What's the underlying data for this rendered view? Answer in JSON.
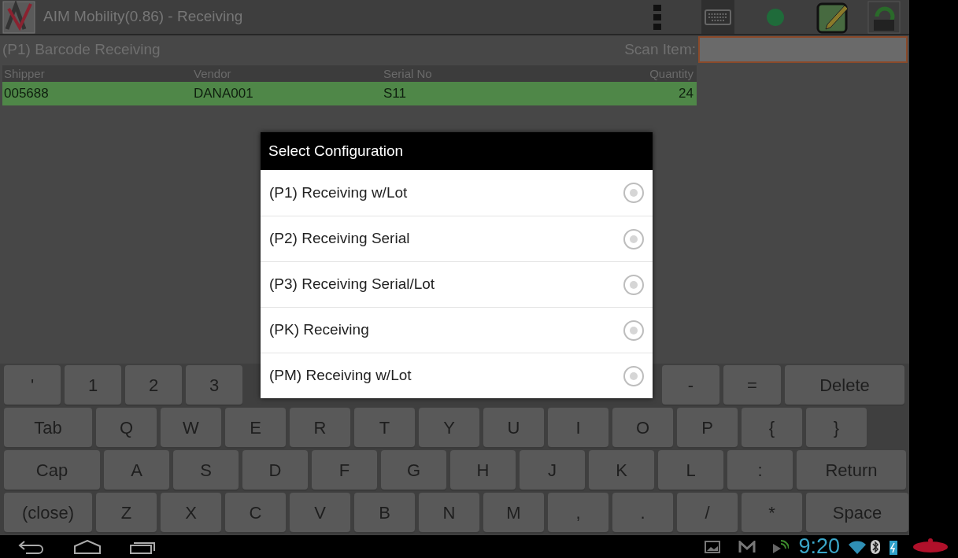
{
  "window": {
    "title": "AIM Mobility(0.86) - Receiving"
  },
  "screen": {
    "title": "(P1) Barcode Receiving",
    "scan_label": "Scan Item:"
  },
  "table": {
    "columns": [
      "Shipper",
      "Vendor",
      "Serial No",
      "Quantity"
    ],
    "rows": [
      {
        "cells": [
          "005688",
          "DANA001",
          "S11",
          "24"
        ],
        "selected": true
      }
    ]
  },
  "dialog": {
    "title": "Select Configuration",
    "options": [
      {
        "label": "(P1) Receiving w/Lot",
        "selected": false
      },
      {
        "label": "(P2) Receiving Serial",
        "selected": false
      },
      {
        "label": "(P3) Receiving Serial/Lot",
        "selected": false
      },
      {
        "label": "(PK) Receiving",
        "selected": false
      },
      {
        "label": "(PM) Receiving w/Lot",
        "selected": false
      }
    ]
  },
  "keyboard": {
    "rows": [
      {
        "keys": [
          "'",
          "1",
          "2",
          "3",
          "-",
          "=",
          "Delete"
        ]
      },
      {
        "keys": [
          "Tab",
          "Q",
          "W",
          "E",
          "R",
          "T",
          "Y",
          "U",
          "I",
          "O",
          "P",
          "{",
          "}"
        ]
      },
      {
        "keys": [
          "Cap",
          "A",
          "S",
          "D",
          "F",
          "G",
          "H",
          "J",
          "K",
          "L",
          ":",
          "Return"
        ]
      },
      {
        "keys": [
          "(close)",
          "Z",
          "X",
          "C",
          "V",
          "B",
          "N",
          "M",
          ",",
          ".",
          "/",
          "*",
          "Space"
        ]
      }
    ]
  },
  "status_bar": {
    "time": "9:20"
  }
}
